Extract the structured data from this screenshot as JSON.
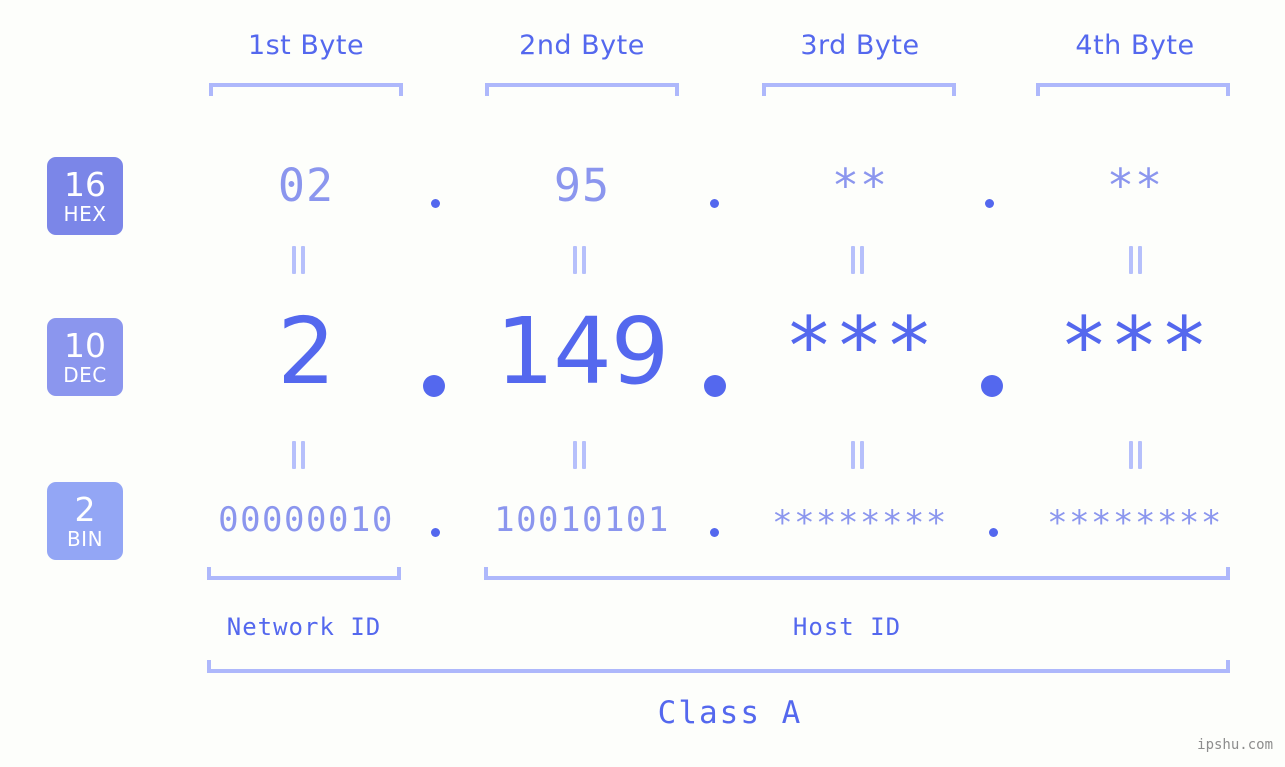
{
  "background_color": "#fdfefb",
  "accent_color": "#5468ee",
  "accent_light_color": "#8b96ee",
  "bracket_color": "#aeb8fb",
  "headers": [
    {
      "label": "1st Byte"
    },
    {
      "label": "2nd Byte"
    },
    {
      "label": "3rd Byte"
    },
    {
      "label": "4th Byte"
    }
  ],
  "bases": [
    {
      "number": "16",
      "name": "HEX",
      "color": "#7b86e8"
    },
    {
      "number": "10",
      "name": "DEC",
      "color": "#8b96ee"
    },
    {
      "number": "2",
      "name": "BIN",
      "color": "#93a6f5"
    }
  ],
  "rows": {
    "hex": {
      "base": "16",
      "base_name": "HEX",
      "bytes": [
        "02",
        "95",
        "**",
        "**"
      ]
    },
    "dec": {
      "base": "10",
      "base_name": "DEC",
      "bytes": [
        "2",
        "149",
        "***",
        "***"
      ]
    },
    "bin": {
      "base": "2",
      "base_name": "BIN",
      "bytes": [
        "00000010",
        "10010101",
        "********",
        "********"
      ]
    }
  },
  "separator": ".",
  "ids": {
    "network": "Network ID",
    "host": "Host ID"
  },
  "class": {
    "label": "Class A"
  },
  "watermark": "ipshu.com"
}
